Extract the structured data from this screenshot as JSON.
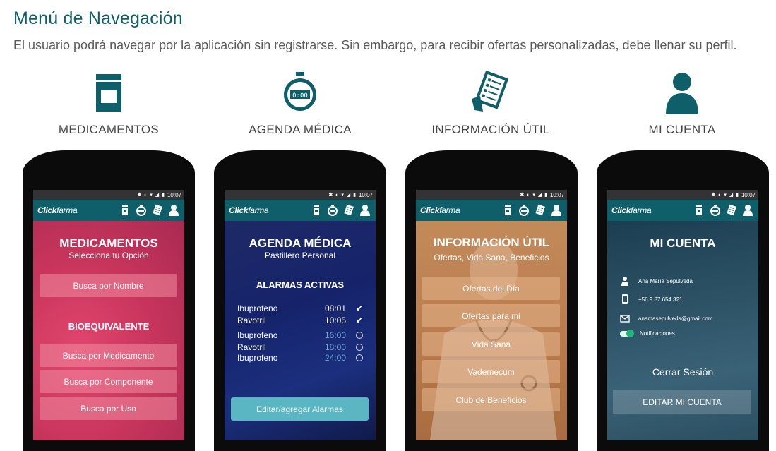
{
  "header": {
    "title": "Menú de Navegación",
    "subtitle": "El usuario podrá navegar por la aplicación sin registrarse. Sin embargo, para recibir ofertas personalizadas, debe llenar su perfil."
  },
  "categories": [
    {
      "label": "MEDICAMENTOS",
      "icon": "pill-bottle-icon"
    },
    {
      "label": "AGENDA MÉDICA",
      "icon": "stopwatch-icon"
    },
    {
      "label": "INFORMACIÓN  ÚTIL",
      "icon": "document-icon"
    },
    {
      "label": "MI CUENTA",
      "icon": "user-icon"
    }
  ],
  "status_bar": {
    "time": "10:07"
  },
  "appbar": {
    "logo_bold": "Click",
    "logo_rest": "farma"
  },
  "colors": {
    "brand": "#0f5f6a",
    "accent_green": "#21b57a"
  },
  "screens": {
    "medicamentos": {
      "title": "MEDICAMENTOS",
      "subtitle": "Selecciona tu Opción",
      "btn_nombre": "Busca por Nombre",
      "section": "BIOEQUIVALENTE",
      "btn_medicamento": "Busca por Medicamento",
      "btn_componente": "Busca por Componente",
      "btn_uso": "Busca por Uso"
    },
    "agenda": {
      "title": "AGENDA MÉDICA",
      "subtitle": "Pastillero Personal",
      "section": "ALARMAS ACTIVAS",
      "alarms": [
        {
          "name": "Ibuprofeno",
          "time": "08:01",
          "active": true
        },
        {
          "name": "Ravotril",
          "time": "10:05",
          "active": true
        },
        {
          "name": "Ibuprofeno",
          "time": "16:00",
          "active": false
        },
        {
          "name": "Ravotril",
          "time": "18:00",
          "active": false
        },
        {
          "name": "Ibuprofeno",
          "time": "24:00",
          "active": false
        }
      ],
      "button": "Editar/agregar Alarmas"
    },
    "informacion": {
      "title": "INFORMACIÓN ÚTIL",
      "subtitle": "Ofertas, Vida Sana, Beneficios",
      "buttons": [
        "Ofertas del Día",
        "Ofertas para mi",
        "Vida Sana",
        "Vademecum",
        "Club de Beneficios"
      ]
    },
    "cuenta": {
      "title": "MI CUENTA",
      "name": "Ana María Sepulveda",
      "phone": "+56 9 87 654 321",
      "email": "anamasepulveda@gmail.com",
      "notifications": "Notificaciones",
      "notifications_on": true,
      "logout": "Cerrar Sesión",
      "edit": "EDITAR MI CUENTA"
    }
  }
}
